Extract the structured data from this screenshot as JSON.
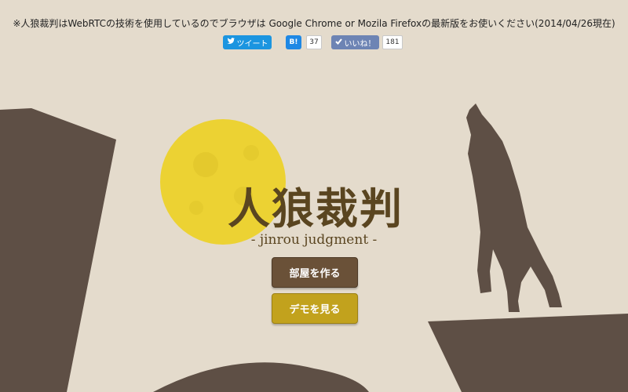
{
  "notice": "※人狼裁判はWebRTCの技術を使用しているのでブラウザは Google Chrome or Mozila Firefoxの最新版をお使いください(2014/04/26現在)",
  "social": {
    "tweet_label": "ツイート",
    "hatena_label": "B!",
    "hatena_count": "37",
    "like_label": "いいね！",
    "like_count": "181"
  },
  "hero": {
    "title": "人狼裁判",
    "subtitle": "- jinrou judgment -"
  },
  "buttons": {
    "create_room": "部屋を作る",
    "demo": "デモを見る"
  },
  "colors": {
    "background": "#e4dbcc",
    "silhouette": "#5e4f45",
    "moon": "#ecd233",
    "title": "#5a4520",
    "create_button": "#6a5138",
    "demo_button": "#c2a21d",
    "twitter": "#1b95e0",
    "hatena": "#1e88e5",
    "facebook": "#6d84b4"
  }
}
